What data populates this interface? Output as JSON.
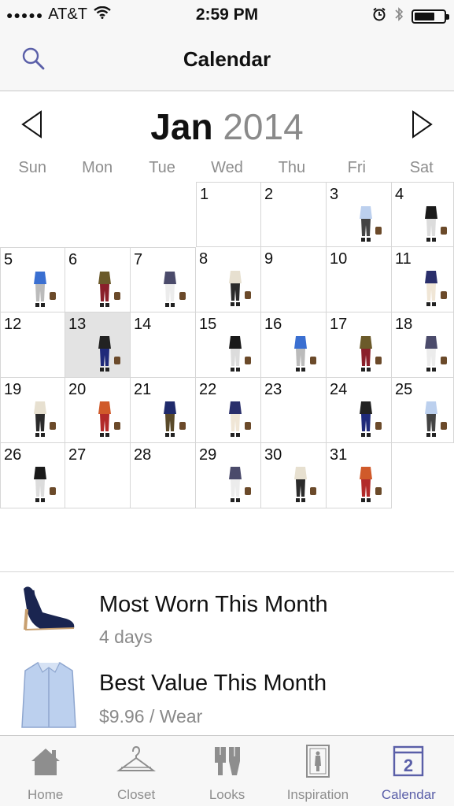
{
  "status_bar": {
    "carrier": "AT&T",
    "time": "2:59 PM",
    "battery_level": 0.7
  },
  "nav": {
    "title": "Calendar",
    "search_icon": "search-icon"
  },
  "calendar": {
    "month": "Jan",
    "year": "2014",
    "weekdays": [
      "Sun",
      "Mon",
      "Tue",
      "Wed",
      "Thu",
      "Fri",
      "Sat"
    ],
    "first_weekday_index": 3,
    "days_in_month": 31,
    "today": 13,
    "days_with_outfits": [
      3,
      4,
      5,
      6,
      7,
      8,
      11,
      13,
      15,
      16,
      17,
      18,
      19,
      20,
      21,
      22,
      24,
      25,
      26,
      29,
      30,
      31
    ]
  },
  "stats": [
    {
      "title": "Most Worn This Month",
      "value": "4 days",
      "image_icon": "shoe-image"
    },
    {
      "title": "Best Value This Month",
      "value": "$9.96 / Wear",
      "image_icon": "shirt-image"
    }
  ],
  "tabs": [
    {
      "label": "Home",
      "icon": "home-icon",
      "active": false
    },
    {
      "label": "Closet",
      "icon": "hanger-icon",
      "active": false
    },
    {
      "label": "Looks",
      "icon": "looks-icon",
      "active": false
    },
    {
      "label": "Inspiration",
      "icon": "inspiration-icon",
      "active": false
    },
    {
      "label": "Calendar",
      "icon": "calendar-icon",
      "active": true,
      "badge": "2"
    }
  ],
  "colors": {
    "accent": "#5a5fa8",
    "grid_line": "#d6d6d6",
    "today_bg": "#e3e3e3",
    "muted_text": "#8a8a8a"
  }
}
